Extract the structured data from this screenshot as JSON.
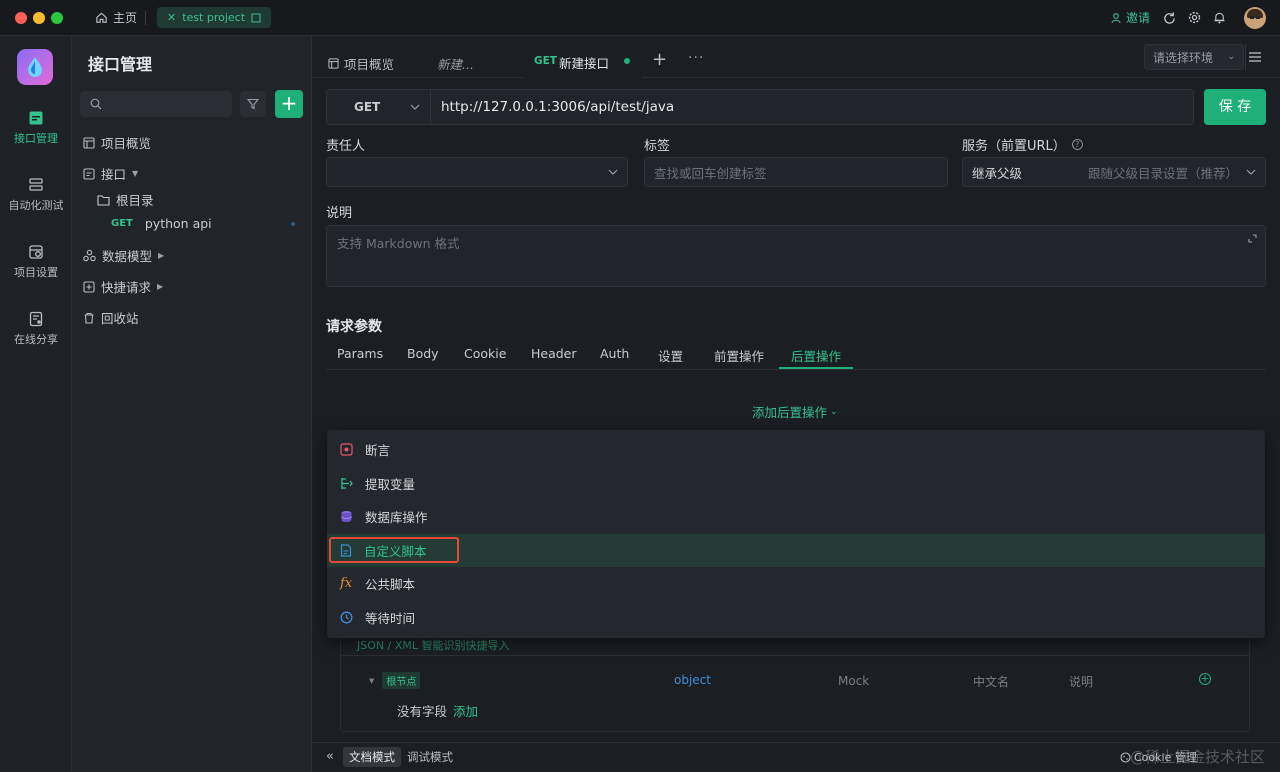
{
  "titlebar": {
    "home_label": "主页",
    "project_tab": "test project",
    "invite_label": "邀请"
  },
  "sidebar": {
    "items": [
      {
        "label": "接口管理"
      },
      {
        "label": "自动化测试"
      },
      {
        "label": "项目设置"
      },
      {
        "label": "在线分享"
      }
    ]
  },
  "nav": {
    "title": "接口管理",
    "tree": {
      "overview": "项目概览",
      "interfaces": "接口",
      "root_dir": "根目录",
      "api_method": "GET",
      "api_name": "python api",
      "data_models": "数据模型",
      "quick_requests": "快捷请求",
      "recycle_bin": "回收站"
    }
  },
  "tabs": {
    "overview": "项目概览",
    "new_draft": "新建...",
    "active_method": "GET",
    "active_label": "新建接口",
    "env_select": "请选择环境"
  },
  "request": {
    "method": "GET",
    "url": "http://127.0.0.1:3006/api/test/java",
    "save_label": "保 存"
  },
  "meta": {
    "owner_label": "责任人",
    "tags_label": "标签",
    "tags_placeholder": "查找或回车创建标签",
    "service_label": "服务（前置URL）",
    "service_value": "继承父级",
    "service_hint": "跟随父级目录设置（推荐）",
    "desc_label": "说明",
    "desc_placeholder": "支持 Markdown 格式"
  },
  "params": {
    "section_title": "请求参数",
    "tabs": [
      "Params",
      "Body",
      "Cookie",
      "Header",
      "Auth",
      "设置",
      "前置操作",
      "后置操作"
    ],
    "active_tab": "后置操作",
    "add_post_label": "添加后置操作"
  },
  "post_menu": {
    "items": [
      {
        "label": "断言",
        "icon": "assertion-icon"
      },
      {
        "label": "提取变量",
        "icon": "extract-variable-icon"
      },
      {
        "label": "数据库操作",
        "icon": "database-icon"
      },
      {
        "label": "自定义脚本",
        "icon": "script-icon"
      },
      {
        "label": "公共脚本",
        "icon": "fx-icon"
      },
      {
        "label": "等待时间",
        "icon": "clock-icon"
      }
    ],
    "highlighted": "自定义脚本"
  },
  "schema": {
    "hint": "JSON / XML 智能识别快捷导入",
    "root_node": "根节点",
    "type": "object",
    "mock": "Mock",
    "cn_name": "中文名",
    "desc": "说明",
    "empty_text": "没有字段",
    "add_link": "添加"
  },
  "footer": {
    "doc_mode": "文档模式",
    "debug_mode": "调试模式",
    "cookie_label": "Cookie 管理",
    "watermark": "@稀土掘金技术社区"
  },
  "colors": {
    "accent": "#1fb07a",
    "accent_text": "#34c28c",
    "highlight_border": "#e5483c",
    "bg": "#1b1e23"
  }
}
